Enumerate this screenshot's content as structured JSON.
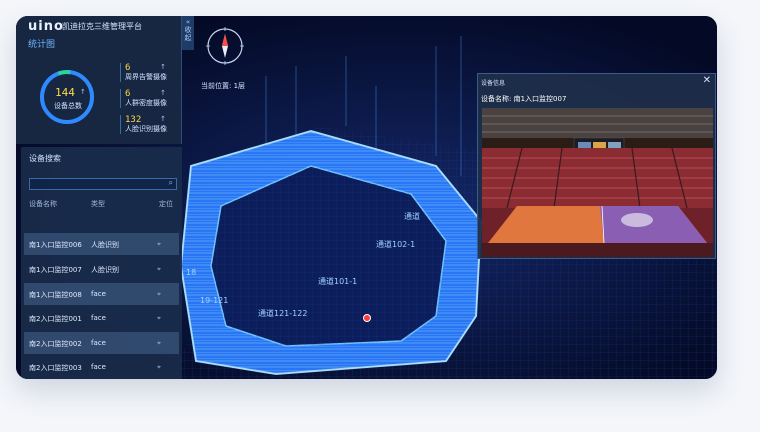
{
  "app": {
    "logo": "uino",
    "platform_title": "凯迪拉克三维管理平台",
    "collapse_label": "收起"
  },
  "stats": {
    "section_title": "统计图",
    "total": {
      "value": "144",
      "arrow": "↑",
      "label": "设备总数"
    },
    "items": [
      {
        "value": "6",
        "label": "周界告警摄像",
        "arrow": "↑"
      },
      {
        "value": "6",
        "label": "人群密度摄像",
        "arrow": "↑"
      },
      {
        "value": "132",
        "label": "人脸识别摄像",
        "arrow": "↑"
      }
    ]
  },
  "search": {
    "title": "设备搜索",
    "placeholder": "",
    "columns": [
      "设备名称",
      "类型",
      "定位"
    ],
    "rows": [
      {
        "name": "南1入口监控006",
        "type": "人脸识别"
      },
      {
        "name": "南1入口监控007",
        "type": "人脸识别"
      },
      {
        "name": "南1入口监控008",
        "type": "face"
      },
      {
        "name": "南2入口监控001",
        "type": "face"
      },
      {
        "name": "南2入口监控002",
        "type": "face"
      },
      {
        "name": "南2入口监控003",
        "type": "face"
      }
    ]
  },
  "scene": {
    "location": "当前位置: 1层",
    "road_labels": [
      "通道121-122",
      "通道101-1",
      "通道102-1",
      "通道",
      "19-121",
      "18"
    ]
  },
  "device_info": {
    "title": "设备信息",
    "name_label": "设备名称:",
    "name_value": "南1入口监控007",
    "close_icon": "✕"
  },
  "colors": {
    "accent": "#2e8bff",
    "highlight": "#ffd84a",
    "background": "#050c2e"
  }
}
